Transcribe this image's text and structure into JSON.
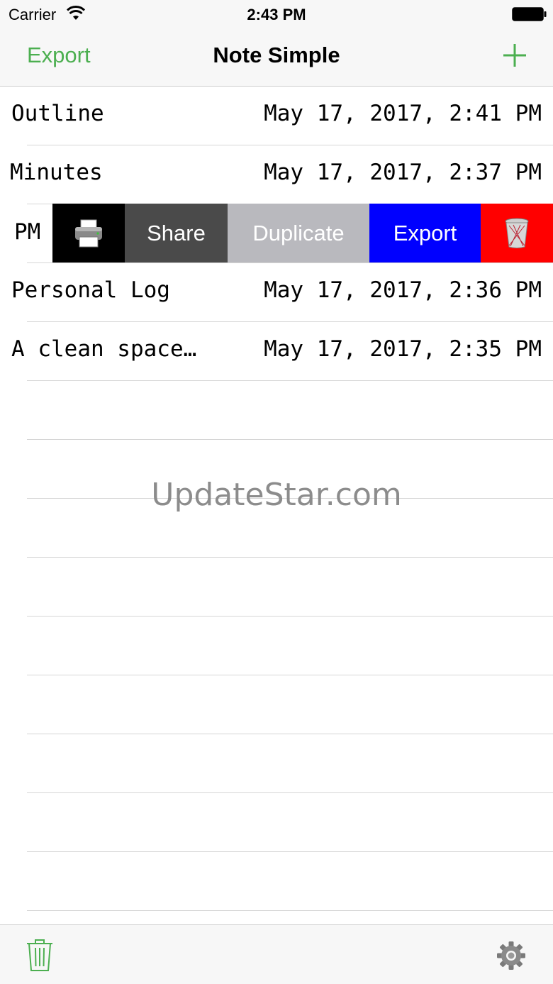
{
  "status_bar": {
    "carrier": "Carrier",
    "time": "2:43 PM",
    "icons": [
      "wifi-icon",
      "battery-icon"
    ]
  },
  "nav": {
    "left_button": "Export",
    "title": "Note Simple",
    "right_icon": "plus-icon",
    "accent_color": "#4caf50"
  },
  "notes": [
    {
      "title": "Outline",
      "date": "May 17, 2017, 2:41 PM"
    },
    {
      "title": "Minutes",
      "date": "May 17, 2017, 2:37 PM"
    },
    {
      "title": "Personal Log",
      "date": "May 17, 2017, 2:36 PM"
    },
    {
      "title": "A clean space…",
      "date": "May 17, 2017, 2:35 PM"
    }
  ],
  "swiped_row": {
    "visible_text": "PM",
    "actions": {
      "print_icon": "printer-icon",
      "share": "Share",
      "duplicate": "Duplicate",
      "export": "Export",
      "delete_icon": "trash-icon"
    },
    "colors": {
      "print": "#000000",
      "share": "#4a4a4a",
      "duplicate": "#b9b9be",
      "export": "#0000ff",
      "delete": "#ff0000"
    }
  },
  "watermark": "UpdateStar.com",
  "toolbar": {
    "left_icon": "trash-icon",
    "right_icon": "gear-icon"
  }
}
